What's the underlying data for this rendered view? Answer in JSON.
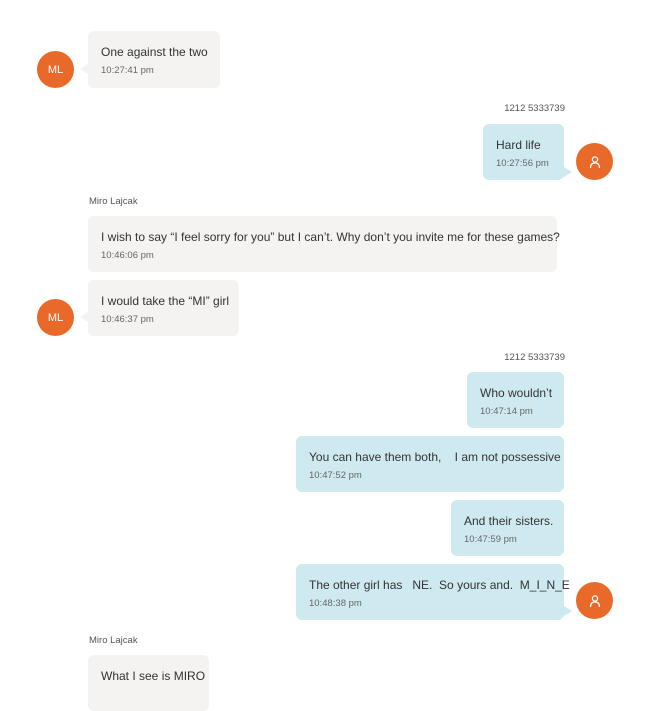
{
  "messages": [
    {
      "sender": "",
      "avatar": "ML",
      "text": "One against the two",
      "time": "10:27:41 pm"
    },
    {
      "sender": "1212 5333739",
      "avatar": "user-icon",
      "text": "Hard life",
      "time": "10:27:56 pm"
    },
    {
      "sender": "Miro Lajcak",
      "text": "I wish to say “I feel sorry for you” but I can’t. Why don’t you invite me for these games?",
      "time": "10:46:06 pm"
    },
    {
      "sender": "",
      "avatar": "ML",
      "text": "I would take the “MI” girl",
      "time": "10:46:37 pm"
    },
    {
      "sender": "1212 5333739",
      "text": "Who wouldn’t",
      "time": "10:47:14 pm"
    },
    {
      "sender": "",
      "text": "You can have them both,    I am not possessive",
      "time": "10:47:52 pm"
    },
    {
      "sender": "",
      "text": "And their sisters.",
      "time": "10:47:59 pm"
    },
    {
      "sender": "",
      "avatar": "user-icon",
      "text": "The other girl has   NE.  So yours and.  M_I_N_E",
      "time": "10:48:38 pm"
    },
    {
      "sender": "Miro Lajcak",
      "text": "What I see is MIRO",
      "time": ""
    }
  ],
  "colors": {
    "incoming_bubble": "#f4f3f1",
    "outgoing_bubble": "#cfe9f1",
    "avatar": "#e8692a"
  }
}
